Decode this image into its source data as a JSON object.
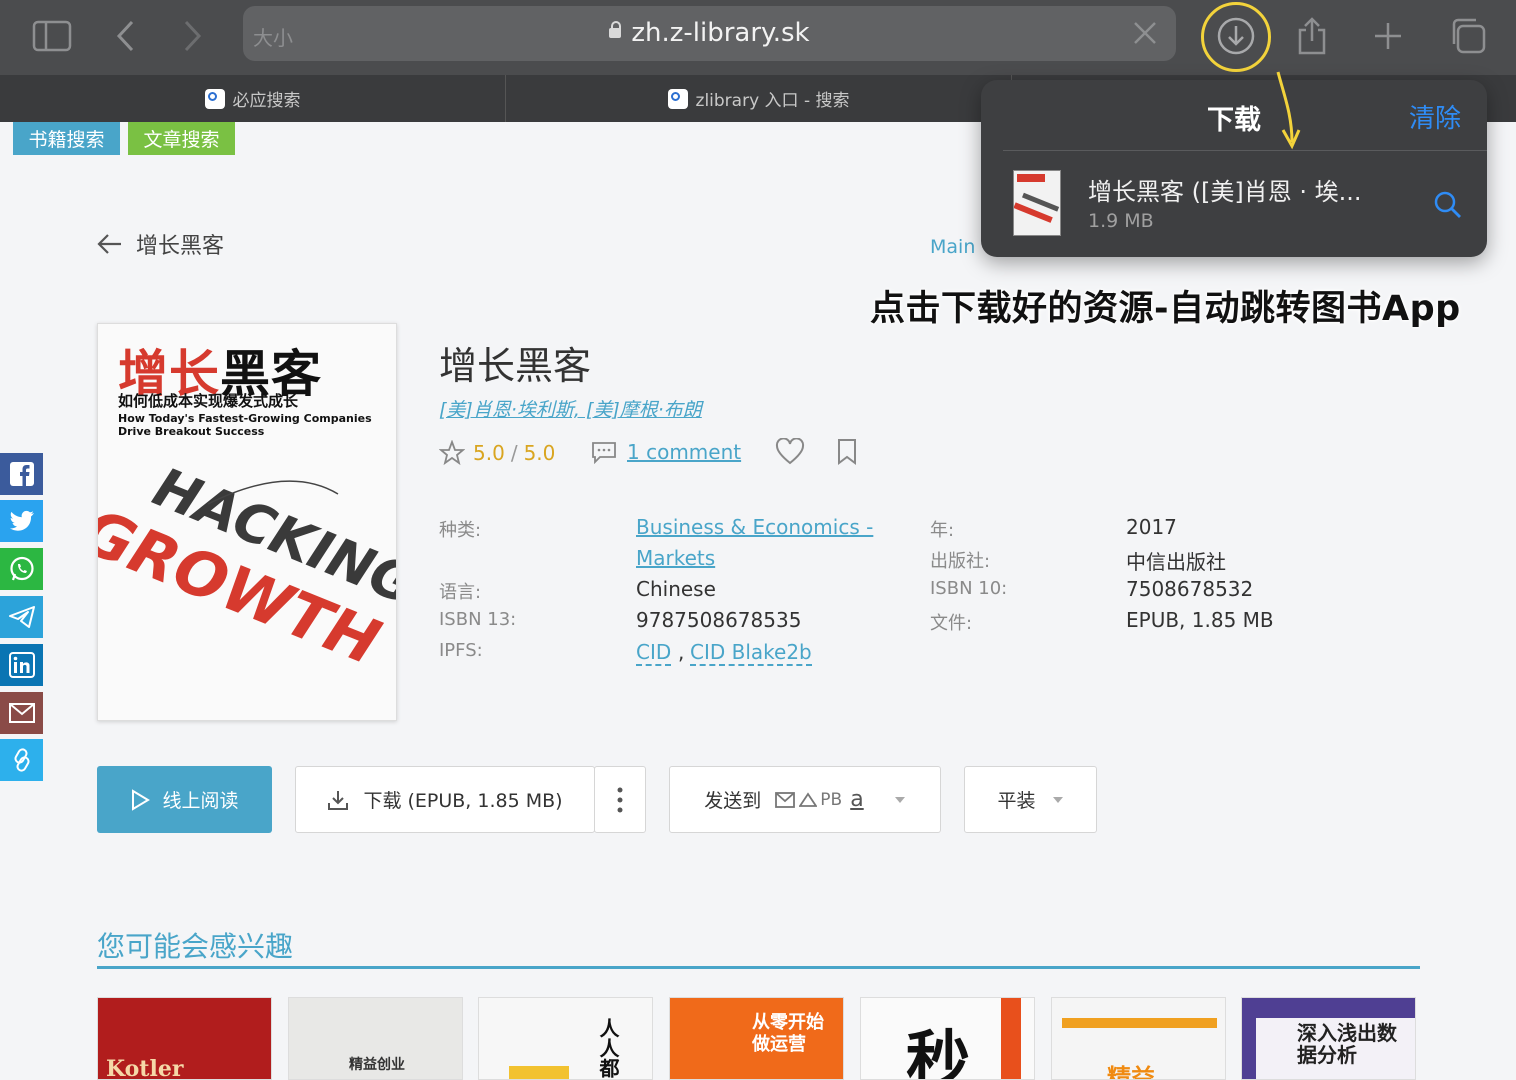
{
  "browser": {
    "aa_label": "大小",
    "url": "zh.z-library.sk",
    "tabs": [
      "必应搜索",
      "zlibrary 入口 - 搜索"
    ]
  },
  "downloads": {
    "title": "下载",
    "clear_label": "清除",
    "item_name": "增长黑客 ([美]肖恩 · 埃...",
    "item_size": "1.9 MB"
  },
  "caption": "点击下载好的资源-自动跳转图书App",
  "nav": {
    "book_search": "书籍搜索",
    "article_search": "文章搜索",
    "back_title": "增长黑客",
    "main_link": "Main"
  },
  "cover": {
    "title_red": "增长",
    "title_black": "黑客",
    "subtitle": "如何低成本实现爆发式成长",
    "en_line1": "How Today's Fastest-Growing Companies",
    "en_line2": "Drive Breakout Success",
    "big1": "HACKING",
    "big2": "GROWTH"
  },
  "book": {
    "title": "增长黑客",
    "authors": "[美]肖恩·埃利斯, [美]摩根·布朗",
    "rating": "5.0",
    "rating_max": "5.0",
    "comments": "1 comment"
  },
  "details": {
    "category_label": "种类:",
    "category_value_1": "Business & Economics -",
    "category_value_2": "Markets",
    "language_label": "语言:",
    "language_value": "Chinese",
    "isbn13_label": "ISBN 13:",
    "isbn13_value": "9787508678535",
    "ipfs_label": "IPFS:",
    "ipfs_cid": "CID",
    "ipfs_comma": ",",
    "ipfs_blake": "CID Blake2b",
    "year_label": "年:",
    "year_value": "2017",
    "publisher_label": "出版社:",
    "publisher_value": "中信出版社",
    "isbn10_label": "ISBN 10:",
    "isbn10_value": "7508678532",
    "file_label": "文件:",
    "file_value": "EPUB, 1.85 MB"
  },
  "actions": {
    "read_online": "线上阅读",
    "download": "下载 (EPUB, 1.85 MB)",
    "send_to": "发送到",
    "send_pb": "PB",
    "send_a": "a",
    "binding": "平装"
  },
  "recommend": {
    "title": "您可能会感兴趣",
    "thumbs": [
      "Kotler",
      "精益创业",
      "人人都",
      "从零开始做运营",
      "秒",
      "精益",
      "深入浅出数据分析"
    ]
  },
  "colors": {
    "accent": "#49a5c9",
    "book_search_bg": "#49a5c9",
    "article_search_bg": "#7ac143",
    "ios_blue": "#2f8cf5",
    "highlight_ring": "#f3d33b"
  }
}
